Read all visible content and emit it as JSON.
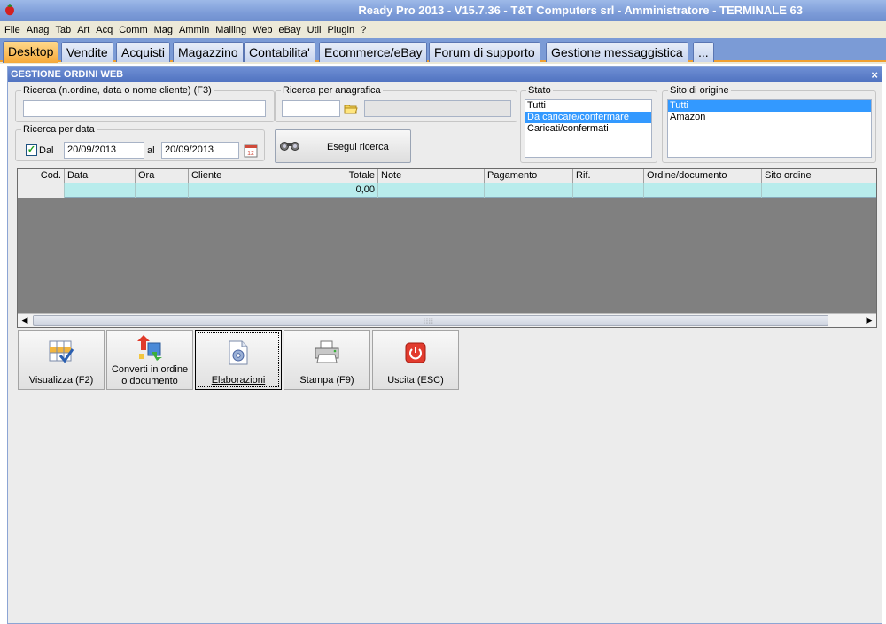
{
  "window": {
    "title": "Ready Pro 2013 - V15.7.36 - T&T Computers srl - Amministratore - TERMINALE 63"
  },
  "menu": [
    "File",
    "Anag",
    "Tab",
    "Art",
    "Acq",
    "Comm",
    "Mag",
    "Ammin",
    "Mailing",
    "Web",
    "eBay",
    "Util",
    "Plugin",
    "?"
  ],
  "tabs": [
    "Desktop",
    "Vendite",
    "Acquisti",
    "Magazzino",
    "Contabilita'",
    "Ecommerce/eBay",
    "Forum di supporto",
    "Gestione messaggistica",
    "..."
  ],
  "form": {
    "title": "GESTIONE ORDINI WEB",
    "close": "×",
    "search_label": "Ricerca (n.ordine, data o nome cliente) (F3)",
    "search_value": "",
    "anagrafica_label": "Ricerca per anagrafica",
    "date_label": "Ricerca per data",
    "dal_label": "Dal",
    "dal_checked": true,
    "date_from": "20/09/2013",
    "al_label": "al",
    "date_to": "20/09/2013",
    "search_button": "Esegui ricerca",
    "stato_label": "Stato",
    "stato_options": [
      "Tutti",
      "Da caricare/confermare",
      "Caricati/confermati"
    ],
    "stato_selected": 1,
    "sito_label": "Sito di origine",
    "sito_options": [
      "Tutti",
      "Amazon"
    ],
    "sito_selected": 0
  },
  "grid": {
    "columns": [
      "Cod.",
      "Data",
      "Ora",
      "Cliente",
      "Totale",
      "Note",
      "Pagamento",
      "Rif.",
      "Ordine/documento",
      "Sito ordine"
    ],
    "row": [
      "",
      "",
      "",
      "",
      "0,00",
      "",
      "",
      "",
      "",
      ""
    ]
  },
  "buttons": {
    "visualizza": "Visualizza (F2)",
    "converti_1": "Converti in ordine",
    "converti_2": "o documento",
    "elaborazioni": "Elaborazioni",
    "stampa": "Stampa (F9)",
    "uscita": "Uscita (ESC)"
  },
  "colors": {
    "accent_tab": "#f6a93a",
    "selection": "#3399ff",
    "grid_row": "#b8ecec"
  }
}
